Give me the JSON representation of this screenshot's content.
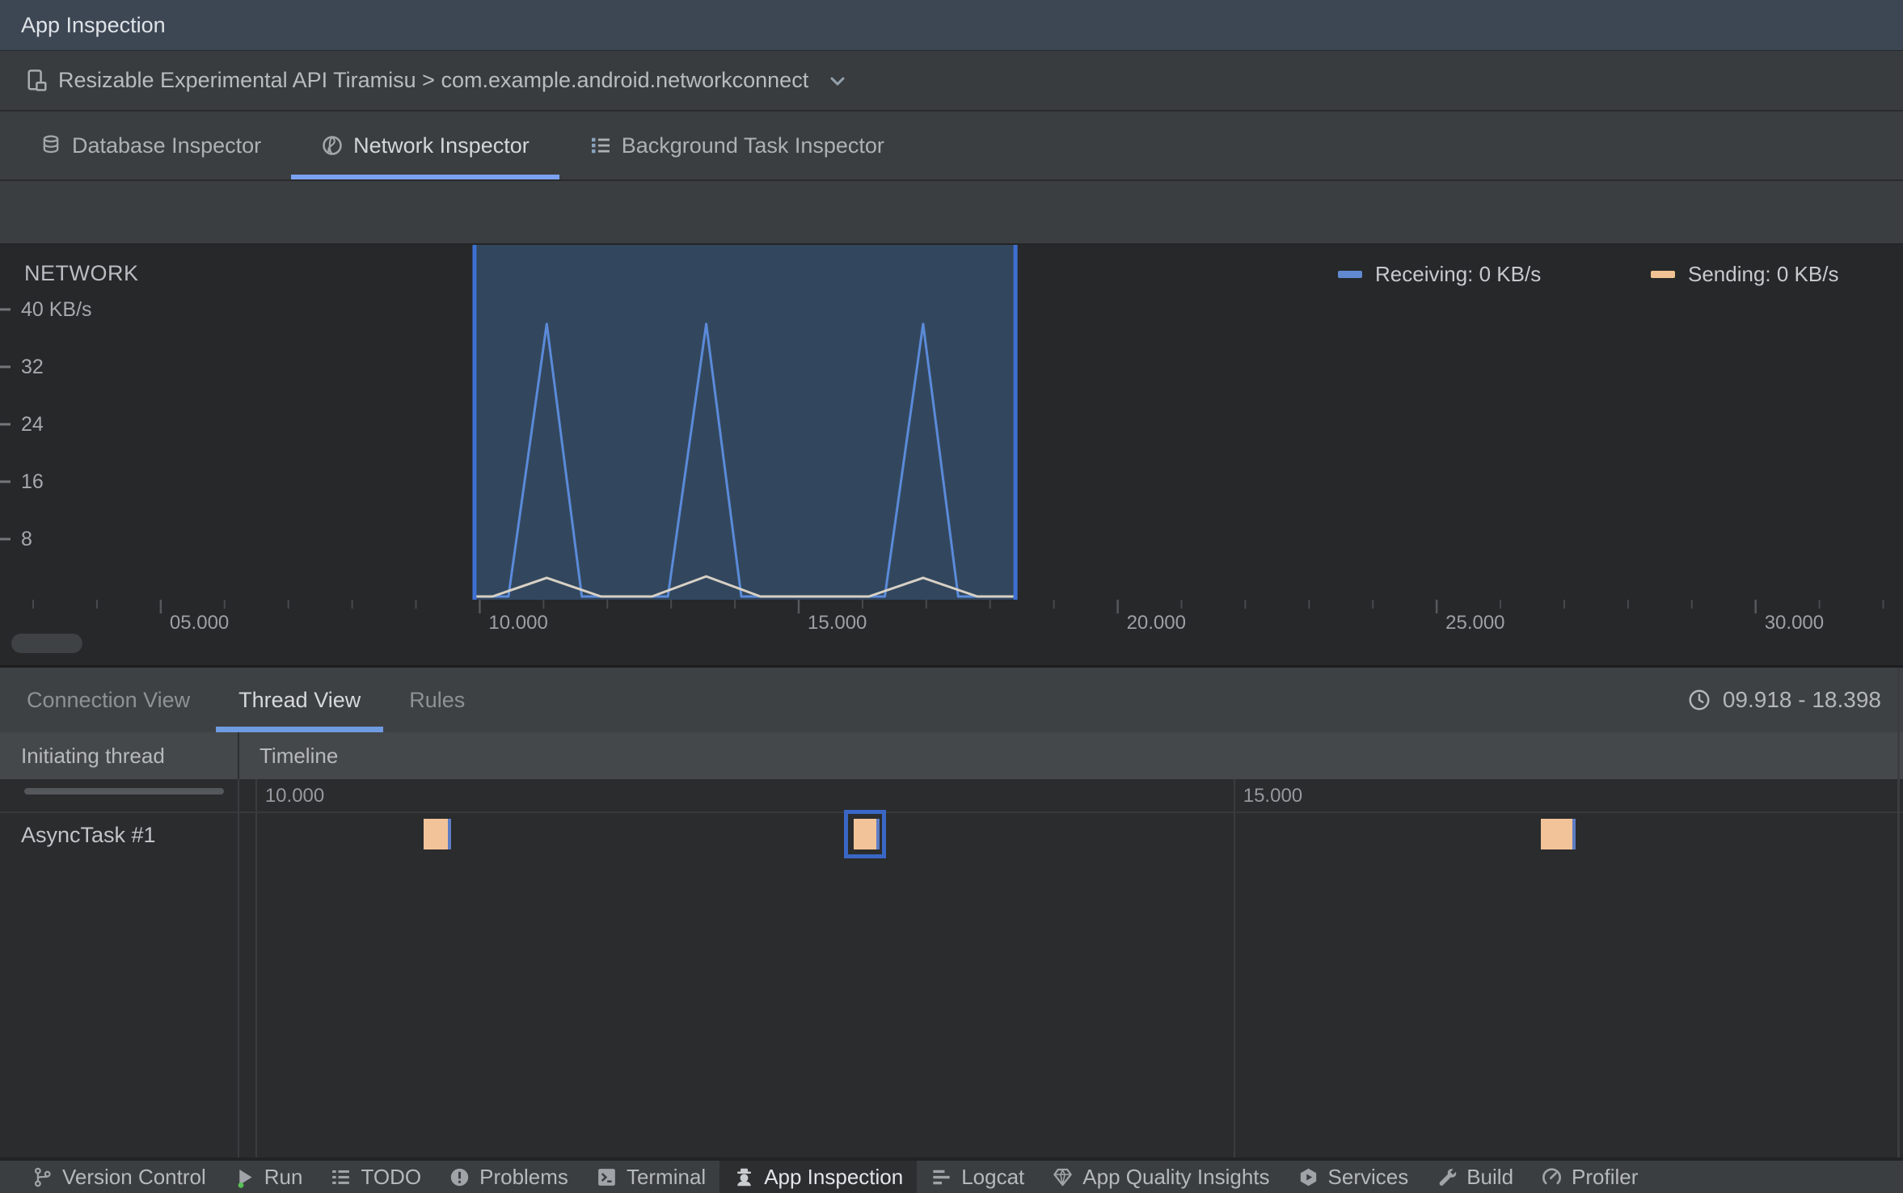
{
  "window": {
    "title": "App Inspection"
  },
  "device_bar": {
    "label": "Resizable Experimental API Tiramisu > com.example.android.networkconnect"
  },
  "inspector_tabs": [
    {
      "label": "Database Inspector",
      "icon": "database",
      "active": false
    },
    {
      "label": "Network Inspector",
      "icon": "globe",
      "active": true
    },
    {
      "label": "Background Task Inspector",
      "icon": "task-list",
      "active": false
    }
  ],
  "chart_data": {
    "type": "area",
    "title": "NETWORK",
    "y_unit": "KB/s",
    "ylim": [
      0,
      49
    ],
    "y_ticks": [
      {
        "value": 40,
        "label": "40 KB/s"
      },
      {
        "value": 32,
        "label": "32"
      },
      {
        "value": 24,
        "label": "24"
      },
      {
        "value": 16,
        "label": "16"
      },
      {
        "value": 8,
        "label": "8"
      }
    ],
    "x_range": [
      2.48,
      32.31
    ],
    "x_minor_step": 1,
    "x_major_ticks": [
      {
        "t": 5,
        "label": "05.000"
      },
      {
        "t": 10,
        "label": "10.000"
      },
      {
        "t": 15,
        "label": "15.000"
      },
      {
        "t": 20,
        "label": "20.000"
      },
      {
        "t": 25,
        "label": "25.000"
      },
      {
        "t": 30,
        "label": "30.000"
      }
    ],
    "selection": {
      "start": 9.918,
      "end": 18.398
    },
    "grid": false,
    "legend_position": "top-right",
    "series": [
      {
        "name": "Receiving",
        "legend_label": "Receiving: 0 KB/s",
        "legend_color": "#6089d0",
        "line_color": "#5b8ad9",
        "points": [
          [
            2.48,
            0
          ],
          [
            10.45,
            0
          ],
          [
            11.05,
            38
          ],
          [
            11.6,
            0
          ],
          [
            12.95,
            0
          ],
          [
            13.55,
            38
          ],
          [
            14.1,
            0
          ],
          [
            16.35,
            0
          ],
          [
            16.95,
            38
          ],
          [
            17.5,
            0
          ],
          [
            32.31,
            0
          ]
        ]
      },
      {
        "name": "Sending",
        "legend_label": "Sending: 0 KB/s",
        "legend_color": "#f0c192",
        "line_color": "#d8d1c5",
        "points": [
          [
            2.48,
            0
          ],
          [
            10.2,
            0
          ],
          [
            11.05,
            2.6
          ],
          [
            11.9,
            0
          ],
          [
            12.7,
            0
          ],
          [
            13.55,
            2.8
          ],
          [
            14.4,
            0
          ],
          [
            16.1,
            0
          ],
          [
            16.95,
            2.6
          ],
          [
            17.8,
            0
          ],
          [
            32.31,
            0
          ]
        ]
      }
    ]
  },
  "thread_panel": {
    "tabs": [
      {
        "label": "Connection View",
        "active": false
      },
      {
        "label": "Thread View",
        "active": true
      },
      {
        "label": "Rules",
        "active": false
      }
    ],
    "time_range": "09.918 - 18.398",
    "columns": [
      "Initiating thread",
      "Timeline"
    ],
    "timeline": {
      "range": [
        9.918,
        18.398
      ],
      "ticks": [
        {
          "t": 10,
          "label": "10.000"
        },
        {
          "t": 15,
          "label": "15.000"
        }
      ]
    },
    "threads": [
      {
        "name": "AsyncTask #1",
        "blocks": [
          {
            "start": 10.86,
            "end": 11.0,
            "selected": false
          },
          {
            "start": 13.06,
            "end": 13.19,
            "selected": true
          },
          {
            "start": 16.57,
            "end": 16.75,
            "selected": false
          }
        ]
      }
    ]
  },
  "toolbar": {
    "items": [
      {
        "label": "Version Control",
        "icon": "git-branch",
        "active": false
      },
      {
        "label": "Run",
        "icon": "run",
        "active": false
      },
      {
        "label": "TODO",
        "icon": "todo",
        "active": false
      },
      {
        "label": "Problems",
        "icon": "problems",
        "active": false
      },
      {
        "label": "Terminal",
        "icon": "terminal",
        "active": false
      },
      {
        "label": "App Inspection",
        "icon": "app-inspection",
        "active": true
      },
      {
        "label": "Logcat",
        "icon": "logcat",
        "active": false
      },
      {
        "label": "App Quality Insights",
        "icon": "insights",
        "active": false
      },
      {
        "label": "Services",
        "icon": "services",
        "active": false
      },
      {
        "label": "Build",
        "icon": "build",
        "active": false
      },
      {
        "label": "Profiler",
        "icon": "profiler",
        "active": false
      }
    ]
  },
  "colors": {
    "accent": "#7ba2f1",
    "selection_fill": "#32475e",
    "selection_border": "#3e70d3",
    "block_fill": "#f2c398",
    "block_strip": "#5d7dc4",
    "block_selected_border": "#3a67c6"
  }
}
